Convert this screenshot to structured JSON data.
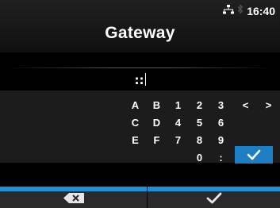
{
  "header": {
    "title": "Gateway",
    "clock": "16:40",
    "status_icons": [
      "lan-icon",
      "bluetooth-icon"
    ]
  },
  "input": {
    "value": "::"
  },
  "keypad": {
    "rows": [
      [
        "A",
        "B",
        "1",
        "2",
        "3",
        "<",
        ">"
      ],
      [
        "C",
        "D",
        "4",
        "5",
        "6"
      ],
      [
        "E",
        "F",
        "7",
        "8",
        "9"
      ],
      [
        "0",
        ":"
      ]
    ],
    "ok_icon": "check-icon"
  },
  "bottom_bar": {
    "left_icon": "backspace-icon",
    "right_icon": "check-icon"
  },
  "colors": {
    "accent": "#1e8fd8",
    "ok_key": "#1d7ec4",
    "keypad_bg": "#1c1c1c",
    "bottom_bar_bg": "#2a2a2a"
  }
}
